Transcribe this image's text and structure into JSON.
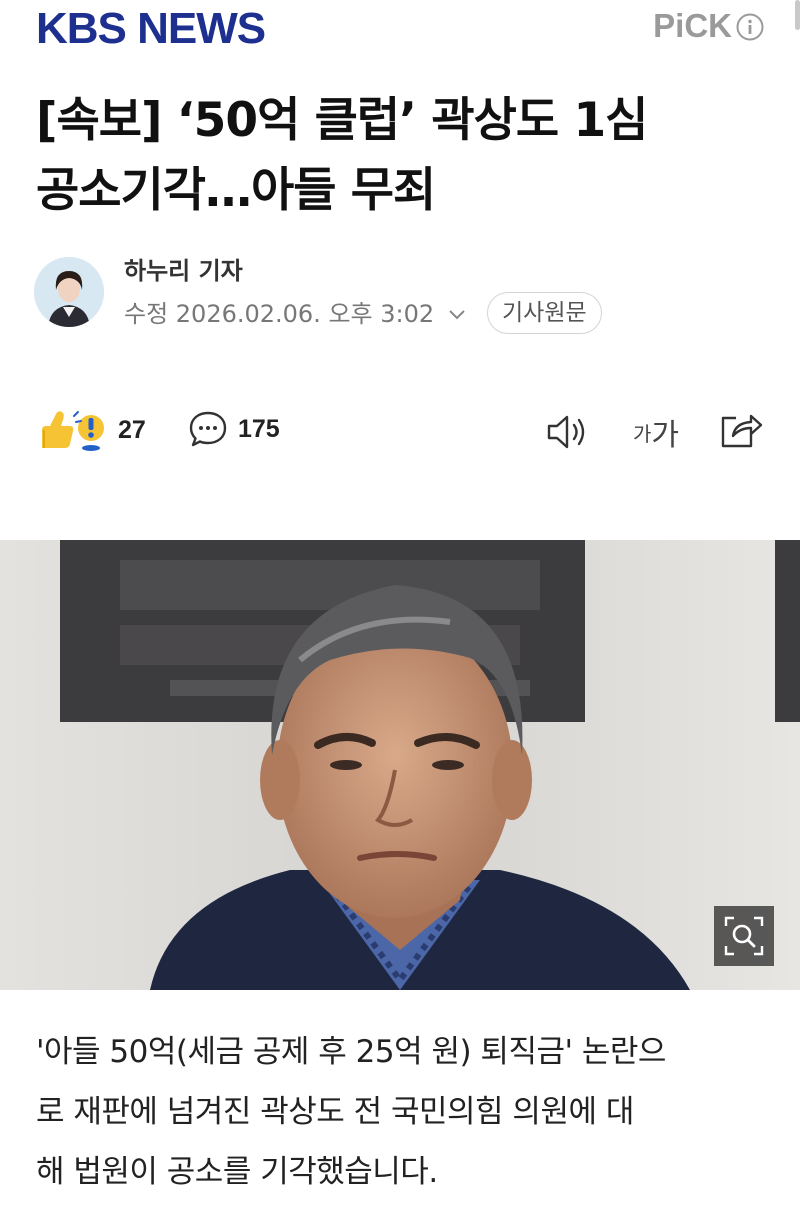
{
  "header": {
    "logo": "KBS NEWS",
    "pick_label": "PiCK",
    "info_icon": "info-circle-icon",
    "brand_color": "#1d2f8f"
  },
  "article": {
    "title_line1": "[속보] ‘50억 클럽’ 곽상도 1심",
    "title_line2": "공소기각…아들 무죄",
    "reporter": "하누리 기자",
    "date": "수정 2026.02.06. 오후 3:02",
    "original_button": "기사원문",
    "body_lines": [
      "'아들 50억(세금 공제 후 25억 원) 퇴직금' 논란으",
      "로 재판에 넘겨진 곽상도 전 국민의힘 의원에 대",
      "해 법원이 공소를 기각했습니다."
    ]
  },
  "actions": {
    "reaction_count": "27",
    "comment_count": "175",
    "font_size_small": "가",
    "font_size_large": "가"
  }
}
